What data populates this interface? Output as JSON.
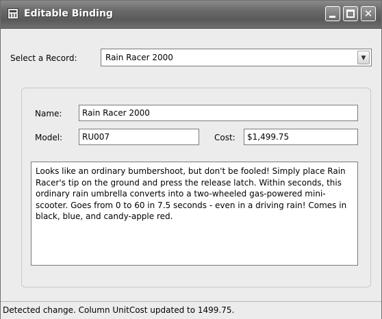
{
  "window": {
    "title": "Editable Binding",
    "title_icon": "app-form-icon",
    "buttons": {
      "minimize_icon": "minimize-icon",
      "maximize_icon": "maximize-icon",
      "close_icon": "close-icon",
      "close_glyph": "✕"
    }
  },
  "selector": {
    "label": "Select a Record:",
    "selected_value": "Rain Racer 2000",
    "arrow_glyph": "▼"
  },
  "details": {
    "name_label": "Name:",
    "name_value": "Rain Racer 2000",
    "model_label": "Model:",
    "model_value": "RU007",
    "cost_label": "Cost:",
    "cost_value": "$1,499.75",
    "description": "Looks like an ordinary bumbershoot, but don't be fooled! Simply place Rain Racer's tip on the ground and press the release latch. Within seconds, this ordinary rain umbrella converts into a two-wheeled gas-powered mini-scooter. Goes from 0 to 60 in 7.5 seconds - even in a driving rain! Comes in black, blue, and candy-apple red."
  },
  "status_bar": {
    "text": "Detected change. Column UnitCost updated to 1499.75."
  }
}
